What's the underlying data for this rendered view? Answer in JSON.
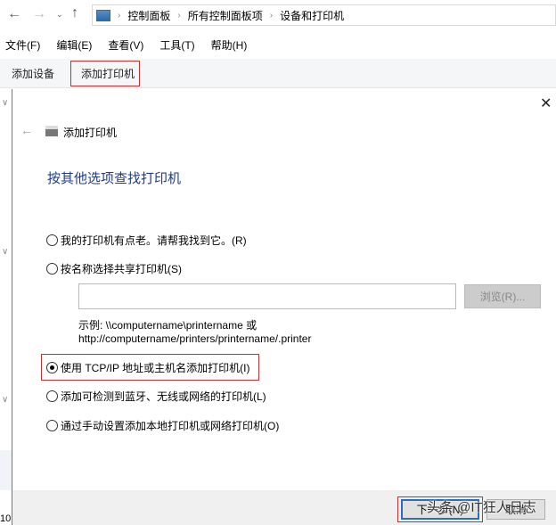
{
  "address": {
    "crumbs": [
      "控制面板",
      "所有控制面板项",
      "设备和打印机"
    ]
  },
  "menu": [
    "文件(F)",
    "编辑(E)",
    "查看(V)",
    "工具(T)",
    "帮助(H)"
  ],
  "toolbar": {
    "add_device": "添加设备",
    "add_printer": "添加打印机"
  },
  "statusbar": {
    "count": "10"
  },
  "dialog": {
    "title": "添加打印机",
    "heading": "按其他选项查找打印机",
    "options": [
      {
        "label": "我的打印机有点老。请帮我找到它。(R)",
        "selected": false
      },
      {
        "label": "按名称选择共享打印机(S)",
        "selected": false
      },
      {
        "label": "使用 TCP/IP 地址或主机名添加打印机(I)",
        "selected": true
      },
      {
        "label": "添加可检测到蓝牙、无线或网络的打印机(L)",
        "selected": false
      },
      {
        "label": "通过手动设置添加本地打印机或网络打印机(O)",
        "selected": false
      }
    ],
    "share_input_value": "",
    "browse_label": "浏览(R)...",
    "example_line1": "示例: \\\\computername\\printername 或",
    "example_line2": "http://computername/printers/printername/.printer",
    "next_label": "下一步(N)",
    "cancel_label": "取消"
  },
  "watermark": "头条 @IT狂人日志"
}
